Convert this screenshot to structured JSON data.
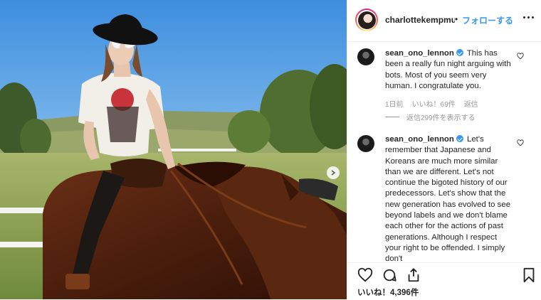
{
  "post": {
    "account": {
      "username": "charlottekempmuhl",
      "separator": "•",
      "follow_label": "フォローする"
    },
    "comments": [
      {
        "username": "sean_ono_lennon",
        "verified": true,
        "text": "This has been a really fun night arguing with bots. Most of you seem very human. I congratulate you.",
        "time": "1日前",
        "likes": "いいね！69件",
        "reply_label": "返信",
        "view_replies": "返信299件を表示する"
      },
      {
        "username": "sean_ono_lennon",
        "verified": true,
        "text": "Let's remember that Japanese and Koreans are much more similar than we are different. Let's not continue the bigoted history of our predecessors. Let's show that the new generation has evolved to see beyond labels and we don't blame each other for the actions of past generations. Although I respect your right to be offended. I simply don't"
      }
    ],
    "likes_count": "いいね！4,396件"
  },
  "icons": {
    "like": "heart-icon",
    "comment": "comment-icon",
    "share": "share-icon",
    "save": "bookmark-icon",
    "more": "more-options-icon",
    "carousel": "chevron-right-icon"
  }
}
